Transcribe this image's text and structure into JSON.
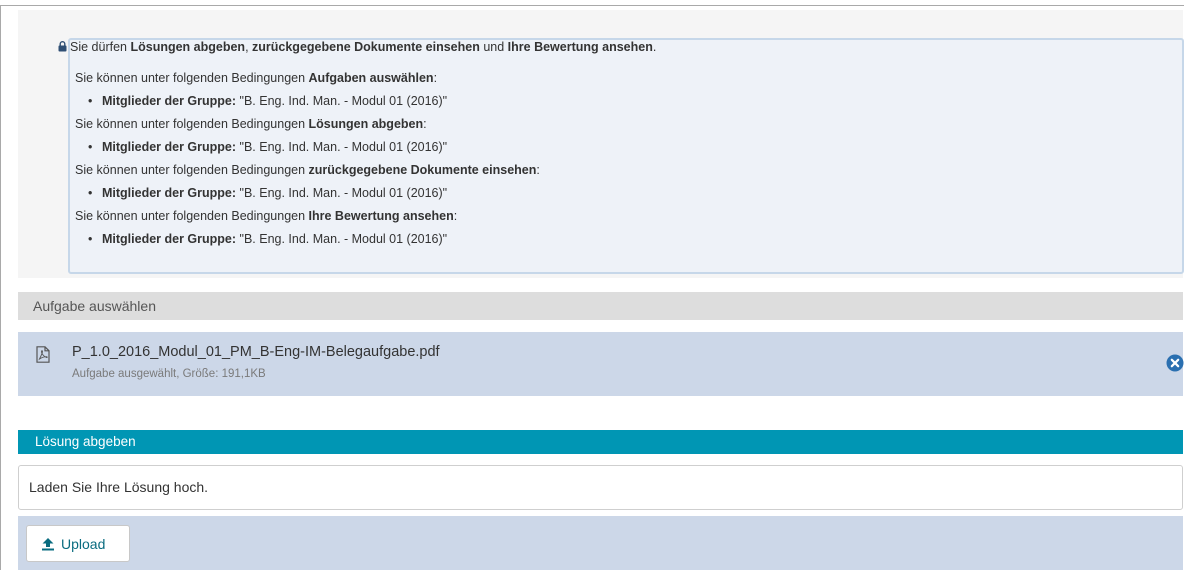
{
  "permissions": {
    "summary": {
      "prefix": "Sie dürfen ",
      "item1": "Lösungen abgeben",
      "sep1": ", ",
      "item2": "zurückgegebene Dokumente einsehen",
      "sep2": " und ",
      "item3": "Ihre Bewertung ansehen",
      "suffix": "."
    },
    "condition_prefix": "Sie können unter folgenden Bedingungen ",
    "member_label": "Mitglieder der Gruppe:",
    "conditions": [
      {
        "action": "Aufgaben auswählen",
        "group": " \"B. Eng. Ind. Man. - Modul 01 (2016)\""
      },
      {
        "action": "Lösungen abgeben",
        "group": " \"B. Eng. Ind. Man. - Modul 01 (2016)\""
      },
      {
        "action": "zurückgegebene Dokumente einsehen",
        "group": " \"B. Eng. Ind. Man. - Modul 01 (2016)\""
      },
      {
        "action": "Ihre Bewertung ansehen",
        "group": " \"B. Eng. Ind. Man. - Modul 01 (2016)\""
      }
    ],
    "colon": ":"
  },
  "task_section": {
    "title": "Aufgabe auswählen",
    "file_name": "P_1.0_2016_Modul_01_PM_B-Eng-IM-Belegaufgabe.pdf",
    "file_meta": "Aufgabe ausgewählt, Größe: 191,1KB",
    "file_icon": "pdf-file-icon",
    "remove_icon": "remove-circle-icon"
  },
  "submit_section": {
    "title": "Lösung abgeben",
    "instruction": "Laden Sie Ihre Lösung hoch.",
    "upload_label": "Upload",
    "upload_icon": "upload-arrow-icon"
  },
  "colors": {
    "accent_header": "#0096b4",
    "file_row_bg": "#ccd7e8",
    "info_border": "#c6d7e9",
    "upload_text": "#0a6c80",
    "remove_icon": "#2a6fb0"
  }
}
